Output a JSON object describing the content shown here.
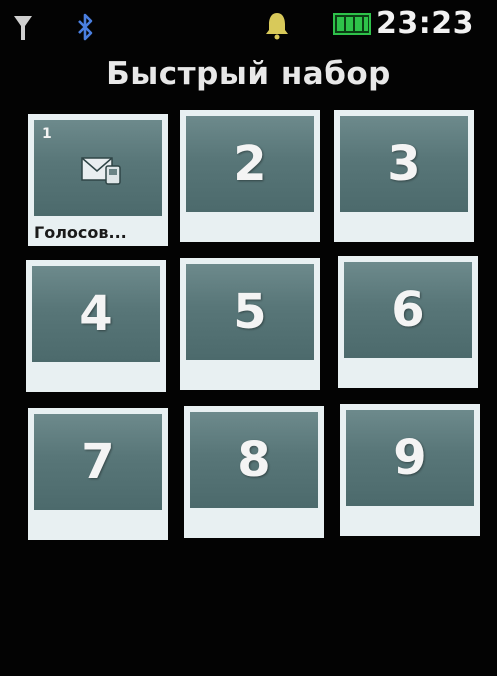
{
  "status_bar": {
    "time": "23:23",
    "icons": [
      "signal-antenna-icon",
      "bluetooth-icon",
      "alarm-bell-icon",
      "battery-full-icon"
    ],
    "colors": {
      "battery": "#1fae3a",
      "bluetooth": "#3a6fd8",
      "bell": "#d6c85a"
    }
  },
  "title": "Быстрый набор",
  "tiles": [
    {
      "index": "1",
      "number": "",
      "caption": "Голосов...",
      "icon": "voicemail-envelope-icon"
    },
    {
      "number": "2"
    },
    {
      "number": "3"
    },
    {
      "number": "4"
    },
    {
      "number": "5"
    },
    {
      "number": "6"
    },
    {
      "number": "7"
    },
    {
      "number": "8"
    },
    {
      "number": "9"
    }
  ],
  "colors": {
    "tile_face": "#587678",
    "tile_frame": "#e8f0f2",
    "background": "#030303"
  }
}
